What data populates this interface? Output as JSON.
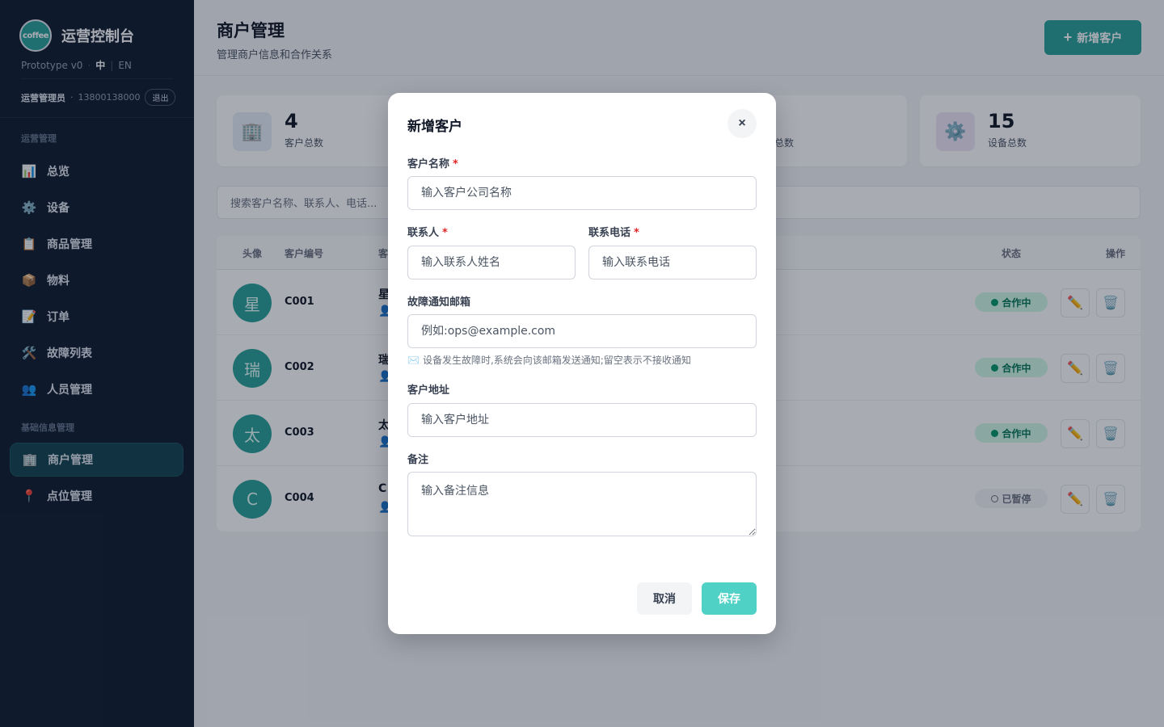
{
  "sidebar": {
    "logo_text": "coffee",
    "title": "运营控制台",
    "version": "Prototype v0",
    "lang_zh": "中",
    "lang_en": "EN",
    "user_role": "运营管理员",
    "user_phone": "13800138000",
    "logout": "退出",
    "section_ops": "运营管理",
    "section_base": "基础信息管理",
    "items": [
      {
        "label": "总览",
        "icon": "📊"
      },
      {
        "label": "设备",
        "icon": "⚙️"
      },
      {
        "label": "商品管理",
        "icon": "📋"
      },
      {
        "label": "物料",
        "icon": "📦"
      },
      {
        "label": "订单",
        "icon": "📝"
      },
      {
        "label": "故障列表",
        "icon": "🛠️"
      },
      {
        "label": "人员管理",
        "icon": "👥"
      },
      {
        "label": "商户管理",
        "icon": "🏢"
      },
      {
        "label": "点位管理",
        "icon": "📍"
      }
    ]
  },
  "header": {
    "title": "商户管理",
    "subtitle": "管理商户信息和合作关系",
    "add_button": "新增客户",
    "add_icon": "+"
  },
  "stats": [
    {
      "value": "4",
      "label": "客户总数",
      "icon": "🏢",
      "color": "#e6eef7"
    },
    {
      "value": "",
      "label": "总数",
      "icon": "",
      "color": "#ffffff"
    },
    {
      "value": "15",
      "label": "设备总数",
      "icon": "⚙️",
      "color": "#efe7f7"
    }
  ],
  "search": {
    "placeholder": "搜索客户名称、联系人、电话..."
  },
  "table": {
    "headers": {
      "avatar": "头像",
      "code": "客户编号",
      "name": "客",
      "status": "状态",
      "actions": "操作"
    },
    "rows": [
      {
        "avatar": "星",
        "code": "C001",
        "name": "星",
        "status": "合作中",
        "active": true
      },
      {
        "avatar": "瑞",
        "code": "C002",
        "name": "瑞",
        "status": "合作中",
        "active": true
      },
      {
        "avatar": "太",
        "code": "C003",
        "name": "太",
        "status": "合作中",
        "active": true
      },
      {
        "avatar": "C",
        "code": "C004",
        "name": "C",
        "status": "已暂停",
        "active": false
      }
    ],
    "edit_icon": "✏️",
    "delete_icon": "🗑️",
    "person_icon": "👤"
  },
  "modal": {
    "title": "新增客户",
    "close": "×",
    "name_label": "客户名称",
    "name_placeholder": "输入客户公司名称",
    "contact_label": "联系人",
    "contact_placeholder": "输入联系人姓名",
    "phone_label": "联系电话",
    "phone_placeholder": "输入联系电话",
    "email_label": "故障通知邮箱",
    "email_placeholder": "例如:ops@example.com",
    "email_hint_icon": "✉️",
    "email_hint": "设备发生故障时,系统会向该邮箱发送通知;留空表示不接收通知",
    "address_label": "客户地址",
    "address_placeholder": "输入客户地址",
    "note_label": "备注",
    "note_placeholder": "输入备注信息",
    "required_mark": "*",
    "cancel": "取消",
    "save": "保存"
  },
  "colors": {
    "accent": "#2aa198",
    "sidebar_bg": "#0f1b2d",
    "save_button": "#4fd1c5"
  }
}
